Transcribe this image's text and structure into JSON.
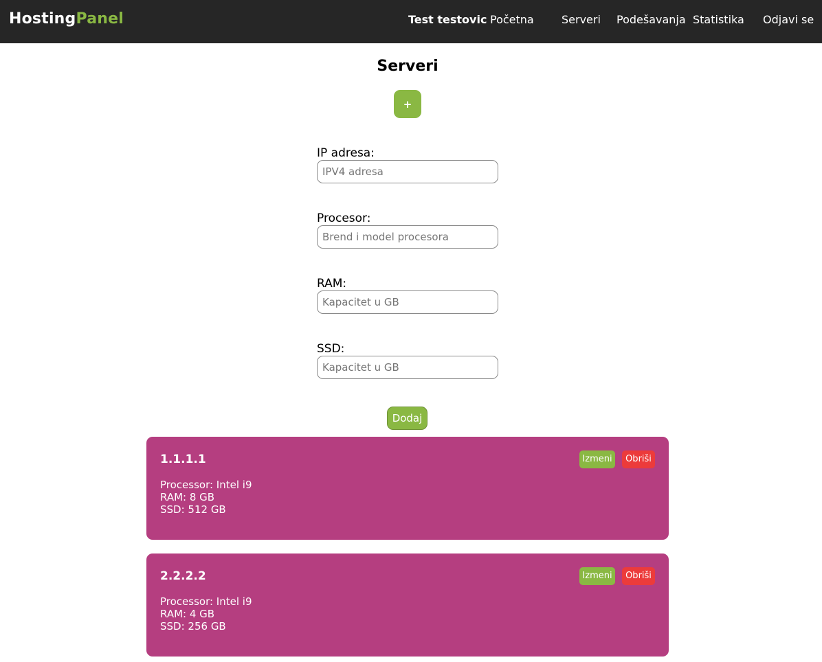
{
  "nav": {
    "brand_first": "Hosting",
    "brand_second": "Panel",
    "user_name": "Test testovic",
    "links": [
      "Početna",
      "Serveri",
      "Podešavanja",
      "Statistika",
      "Odjavi se"
    ]
  },
  "main": {
    "title": "Serveri",
    "add_toggle_label": "+"
  },
  "form": {
    "fields": [
      {
        "label": "IP adresa:",
        "placeholder": "IPV4 adresa",
        "value": ""
      },
      {
        "label": "Procesor:",
        "placeholder": "Brend i model procesora",
        "value": ""
      },
      {
        "label": "RAM:",
        "placeholder": "Kapacitet u GB",
        "value": ""
      },
      {
        "label": "SSD:",
        "placeholder": "Kapacitet u GB",
        "value": ""
      }
    ],
    "submit_label": "Dodaj"
  },
  "servers": [
    {
      "ip": "1.1.1.1",
      "processor": "Processor: Intel i9",
      "ram": "RAM: 8 GB",
      "ssd": "SSD: 512 GB",
      "edit_label": "Izmeni",
      "delete_label": "Obriši"
    },
    {
      "ip": "2.2.2.2",
      "processor": "Processor: Intel i9",
      "ram": "RAM: 4 GB",
      "ssd": "SSD: 256 GB",
      "edit_label": "Izmeni",
      "delete_label": "Obriši"
    }
  ],
  "colors": {
    "navbar_bg": "#262626",
    "accent_green": "#8ab843",
    "card_bg": "#b53e80",
    "delete_red": "#ec3b3b"
  }
}
